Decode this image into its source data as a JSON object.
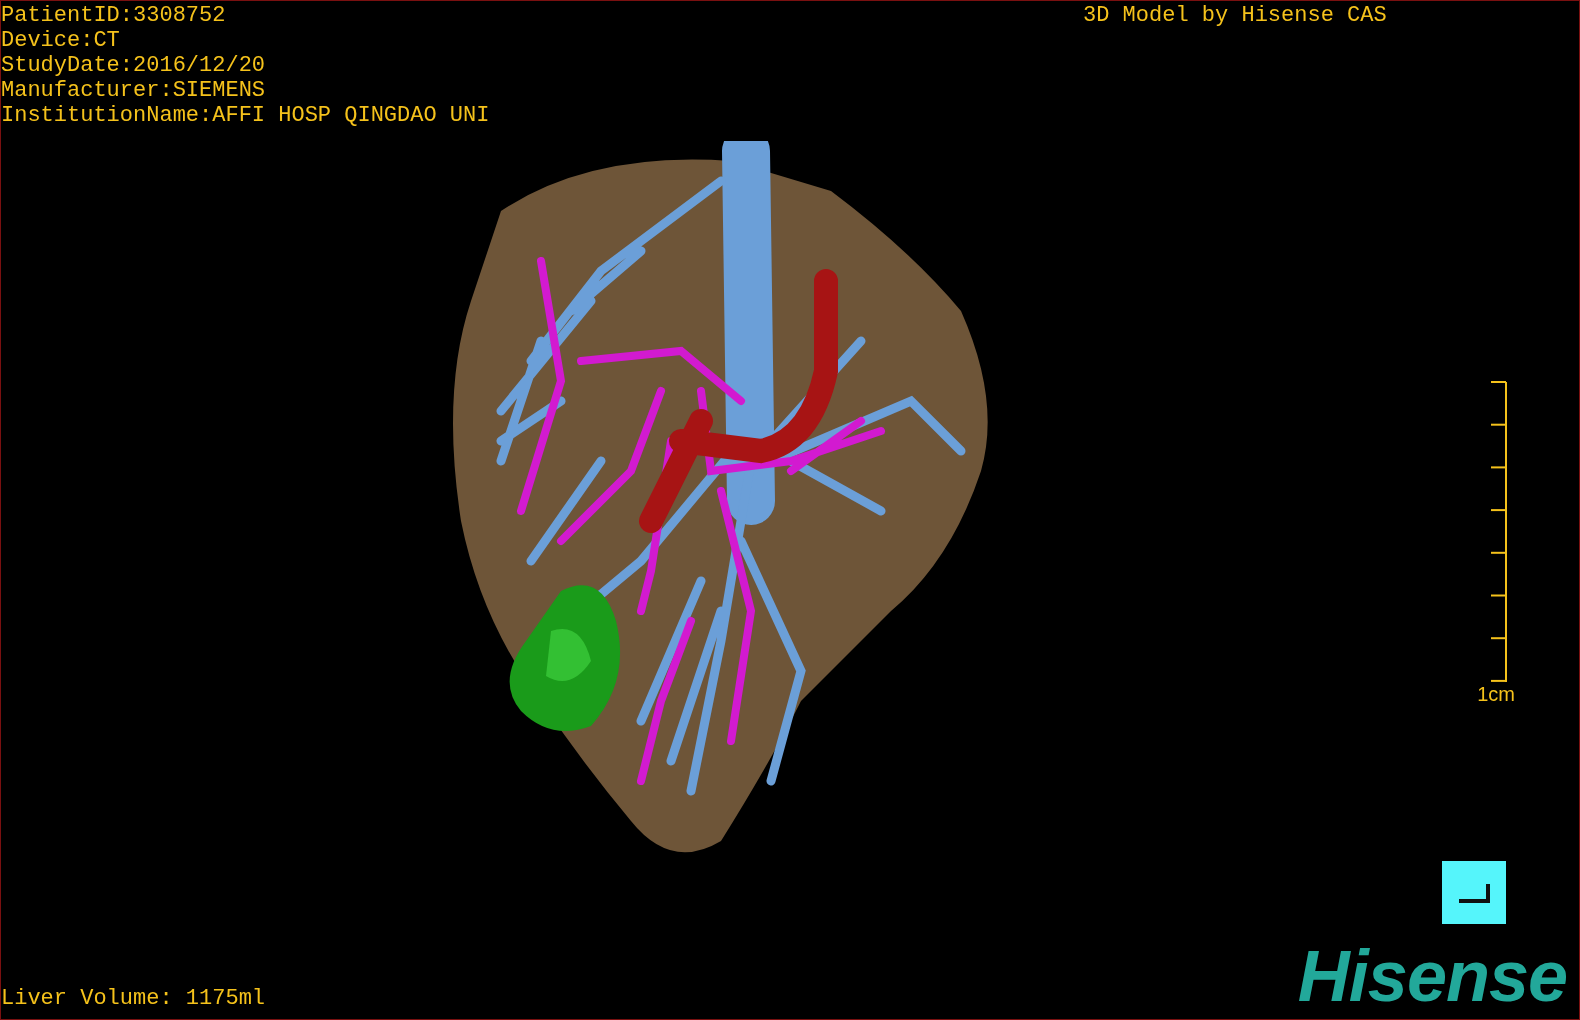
{
  "patient_info": [
    "PatientID:3308752",
    "Device:CT",
    "StudyDate:2016/12/20",
    "Manufacturer:SIEMENS",
    "InstitutionName:AFFI HOSP QINGDAO UNI"
  ],
  "title": "3D Model by Hisense CAS",
  "scale_bar": {
    "label": "1cm"
  },
  "liver_volume": "Liver Volume: 1175ml",
  "logo": "Hisense"
}
